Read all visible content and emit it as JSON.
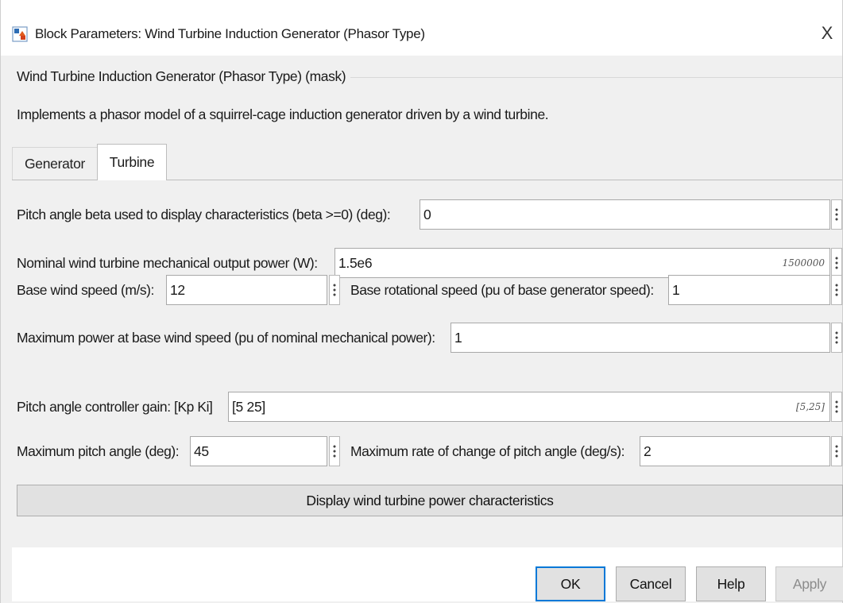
{
  "window": {
    "title": "Block Parameters: Wind Turbine Induction Generator (Phasor Type)",
    "close_glyph": "X",
    "icon": "simulink-block-icon"
  },
  "mask": {
    "header": "Wind Turbine Induction Generator (Phasor Type) (mask)",
    "description": "Implements a phasor model of a squirrel-cage induction generator driven by a wind turbine."
  },
  "tabs": [
    {
      "label": "Generator",
      "active": false
    },
    {
      "label": "Turbine",
      "active": true
    }
  ],
  "params": {
    "pitch_beta": {
      "label": "Pitch angle beta used to display characteristics (beta >=0)  (deg):",
      "value": "0"
    },
    "nominal_power": {
      "label": "Nominal wind turbine mechanical output power (W):",
      "value": "1.5e6",
      "hint": "1500000"
    },
    "base_wind_speed": {
      "label": "Base wind speed (m/s):",
      "value": "12"
    },
    "base_rot_speed": {
      "label": "Base rotational speed (pu of base generator speed):",
      "value": "1"
    },
    "max_power": {
      "label": "Maximum power at base wind speed (pu of nominal mechanical power):",
      "value": "1"
    },
    "pitch_gain": {
      "label": "Pitch angle controller gain: [Kp Ki]",
      "value": "[5 25]",
      "hint": "[5,25]"
    },
    "max_pitch": {
      "label": "Maximum pitch angle (deg):",
      "value": "45"
    },
    "max_rate": {
      "label": "Maximum rate of change of pitch angle (deg/s):",
      "value": "2"
    }
  },
  "display_button": "Display wind turbine power characteristics",
  "buttons": {
    "ok": "OK",
    "cancel": "Cancel",
    "help": "Help",
    "apply": "Apply"
  },
  "colors": {
    "focus_accent": "#0078d7",
    "dialog_bg": "#f0f0f0",
    "field_bg": "#ffffff"
  }
}
